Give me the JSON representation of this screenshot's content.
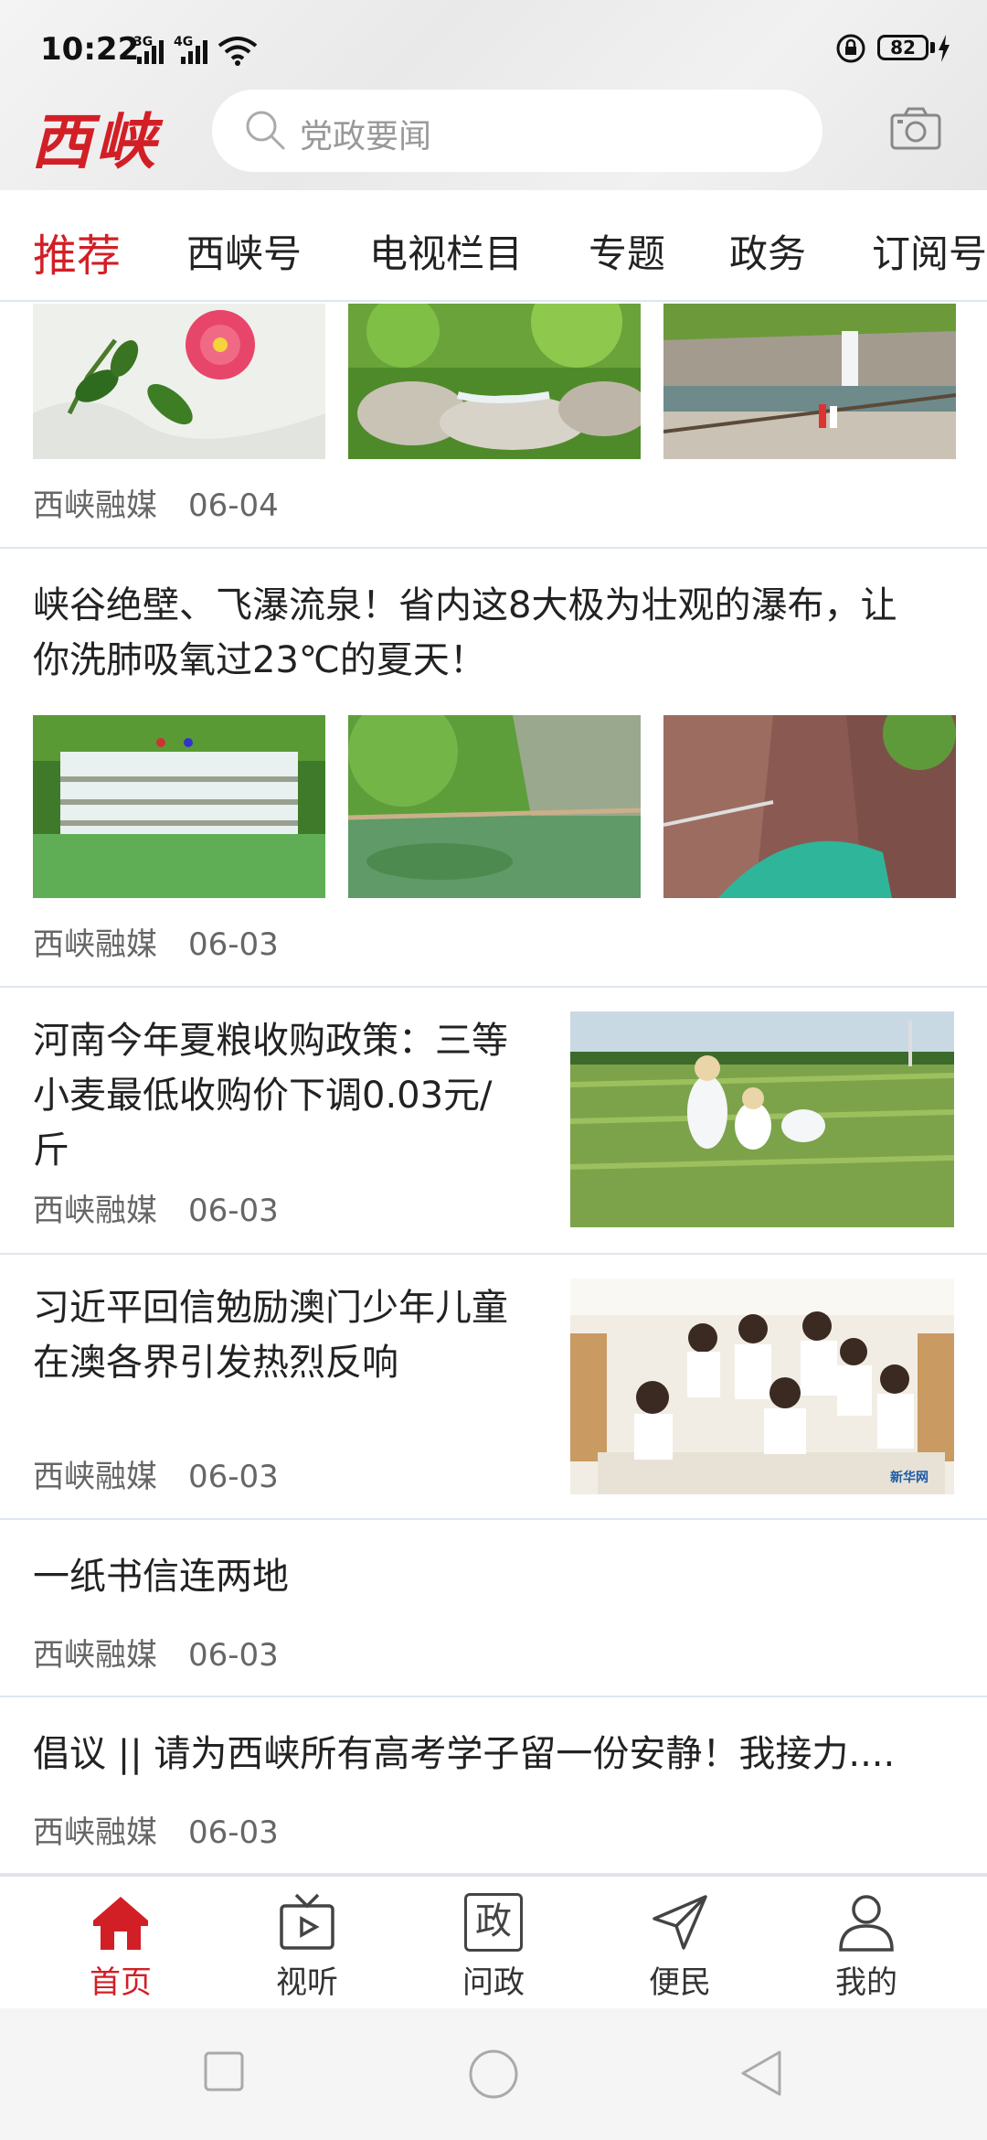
{
  "status_bar": {
    "time": "10:22",
    "net1": "3G",
    "net2": "4G",
    "battery": "82"
  },
  "header": {
    "logo": "西峡",
    "search_placeholder": "党政要闻"
  },
  "tabs": [
    {
      "label": "推荐",
      "active": true
    },
    {
      "label": "西峡号"
    },
    {
      "label": "电视栏目"
    },
    {
      "label": "专题"
    },
    {
      "label": "政务"
    },
    {
      "label": "订阅号"
    }
  ],
  "feed": {
    "items": [
      {
        "source": "西峡融媒",
        "date": "06-04"
      },
      {
        "title_line1": "峡谷绝壁、飞瀑流泉！省内这8大极为壮观的瀑布，让",
        "title_line2": "你洗肺吸氧过23℃的夏天！",
        "source": "西峡融媒",
        "date": "06-03"
      },
      {
        "title_line1": "河南今年夏粮收购政策：三等",
        "title_line2": "小麦最低收购价下调0.03元/",
        "title_line3": "斤",
        "source": "西峡融媒",
        "date": "06-03"
      },
      {
        "title_line1": "习近平回信勉励澳门少年儿童",
        "title_line2": "在澳各界引发热烈反响",
        "source": "西峡融媒",
        "date": "06-03",
        "watermark": "新华网"
      },
      {
        "title_line1": "一纸书信连两地",
        "source": "西峡融媒",
        "date": "06-03"
      },
      {
        "title_line1": "倡议 || 请为西峡所有高考学子留一份安静！我接力....",
        "source": "西峡融媒",
        "date": "06-03"
      }
    ]
  },
  "bottom_nav": [
    {
      "label": "首页",
      "icon": "home-icon",
      "active": true
    },
    {
      "label": "视听",
      "icon": "tv-icon"
    },
    {
      "label": "问政",
      "icon": "zheng-icon",
      "glyph": "政"
    },
    {
      "label": "便民",
      "icon": "send-icon"
    },
    {
      "label": "我的",
      "icon": "user-icon"
    }
  ],
  "colors": {
    "accent": "#d21f26",
    "divider": "#dfe6ee"
  }
}
